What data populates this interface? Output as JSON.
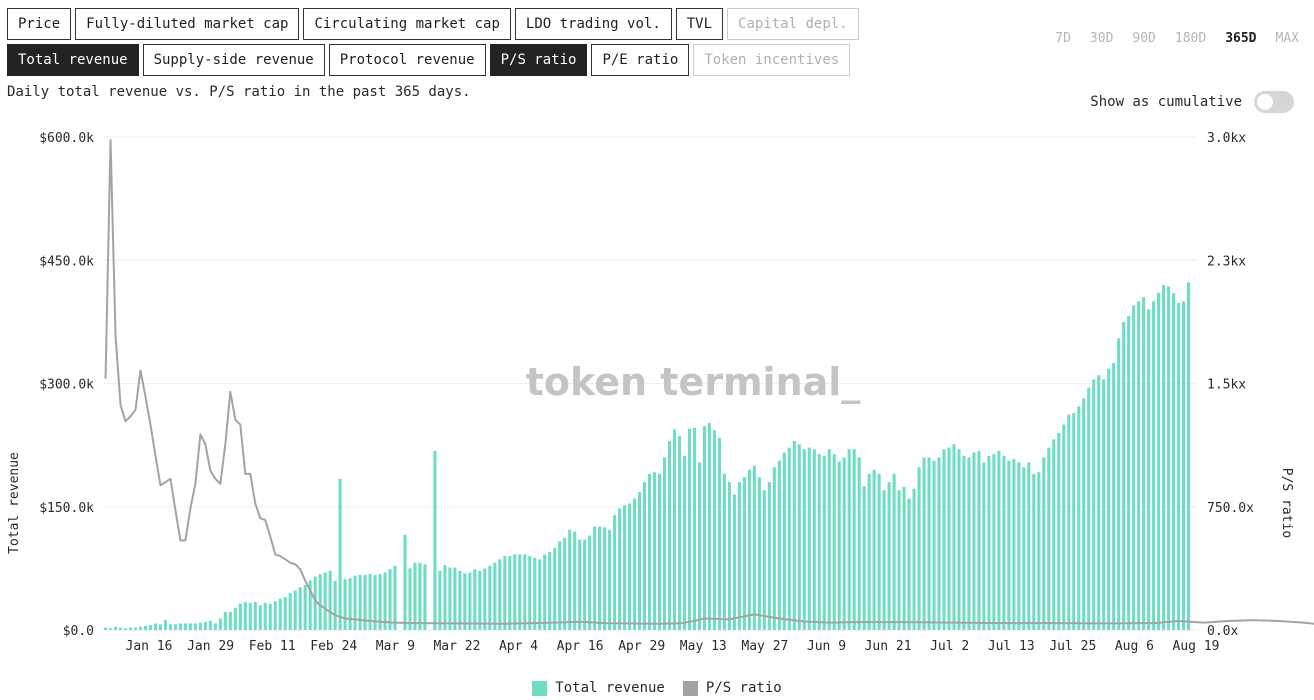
{
  "tabs_row1": [
    {
      "label": "Price",
      "state": "normal"
    },
    {
      "label": "Fully-diluted market cap",
      "state": "normal"
    },
    {
      "label": "Circulating market cap",
      "state": "normal"
    },
    {
      "label": "LDO trading vol.",
      "state": "normal"
    },
    {
      "label": "TVL",
      "state": "normal"
    },
    {
      "label": "Capital depl.",
      "state": "disabled"
    }
  ],
  "tabs_row2": [
    {
      "label": "Total revenue",
      "state": "active"
    },
    {
      "label": "Supply-side revenue",
      "state": "normal"
    },
    {
      "label": "Protocol revenue",
      "state": "normal"
    },
    {
      "label": "P/S ratio",
      "state": "active"
    },
    {
      "label": "P/E ratio",
      "state": "normal"
    },
    {
      "label": "Token incentives",
      "state": "disabled"
    }
  ],
  "ranges": [
    {
      "label": "7D",
      "active": false
    },
    {
      "label": "30D",
      "active": false
    },
    {
      "label": "90D",
      "active": false
    },
    {
      "label": "180D",
      "active": false
    },
    {
      "label": "365D",
      "active": true
    },
    {
      "label": "MAX",
      "active": false
    }
  ],
  "subtitle": "Daily total revenue vs. P/S ratio in the past 365 days.",
  "cumulative_label": "Show as cumulative",
  "cumulative_on": false,
  "watermark": "token terminal_",
  "colors": {
    "revenue": "#6fdcc3",
    "ps": "#a3a3a3",
    "grid": "#eeeeee",
    "text": "#2a2a2a"
  },
  "chart_data": {
    "type": "bar+line",
    "ylabel_left": "Total revenue",
    "ylabel_right": "P/S ratio",
    "left_ticks": [
      "$0.0",
      "$150.0k",
      "$300.0k",
      "$450.0k",
      "$600.0k"
    ],
    "right_ticks": [
      "0.0x",
      "750.0x",
      "1.5kx",
      "2.3kx",
      "3.0kx"
    ],
    "ylim_left": [
      0,
      600000
    ],
    "ylim_right": [
      0,
      3000
    ],
    "x_ticks": [
      "Jan 16",
      "Jan 29",
      "Feb 11",
      "Feb 24",
      "Mar 9",
      "Mar 22",
      "Apr 4",
      "Apr 16",
      "Apr 29",
      "May 13",
      "May 27",
      "Jun 9",
      "Jun 21",
      "Jul 2",
      "Jul 13",
      "Jul 25",
      "Aug 6",
      "Aug 19"
    ],
    "grid": true,
    "legend": "bottom-center",
    "series": [
      {
        "name": "Total revenue",
        "kind": "bar",
        "values": [
          3000,
          2000,
          4000,
          3000,
          2000,
          3000,
          3000,
          4000,
          5000,
          6000,
          8000,
          7000,
          12000,
          7000,
          7000,
          8000,
          8000,
          8000,
          8000,
          9000,
          10000,
          11000,
          8000,
          14000,
          22000,
          22000,
          27000,
          32000,
          34000,
          33000,
          34000,
          30000,
          33000,
          32000,
          35000,
          38000,
          40000,
          45000,
          48000,
          52000,
          55000,
          60000,
          65000,
          68000,
          70000,
          72000,
          60000,
          184000,
          62000,
          63000,
          66000,
          67000,
          67000,
          68000,
          67000,
          68000,
          70000,
          74000,
          78000,
          0,
          116000,
          75000,
          82000,
          82000,
          80000,
          0,
          218000,
          72000,
          79000,
          76000,
          76000,
          72000,
          69000,
          70000,
          74000,
          72000,
          75000,
          78000,
          82000,
          86000,
          90000,
          90000,
          92000,
          92000,
          92000,
          90000,
          88000,
          86000,
          92000,
          95000,
          100000,
          108000,
          112000,
          122000,
          120000,
          110000,
          110000,
          115000,
          126000,
          126000,
          125000,
          122000,
          140000,
          148000,
          152000,
          154000,
          160000,
          168000,
          180000,
          190000,
          192000,
          190000,
          210000,
          230000,
          244000,
          236000,
          212000,
          245000,
          246000,
          204000,
          248000,
          252000,
          243000,
          234000,
          190000,
          180000,
          165000,
          180000,
          186000,
          195000,
          200000,
          186000,
          170000,
          180000,
          198000,
          206000,
          216000,
          222000,
          230000,
          226000,
          220000,
          222000,
          220000,
          214000,
          212000,
          220000,
          214000,
          205000,
          210000,
          220000,
          220000,
          210000,
          175000,
          190000,
          195000,
          190000,
          170000,
          180000,
          190000,
          170000,
          174000,
          160000,
          172000,
          198000,
          210000,
          210000,
          206000,
          210000,
          220000,
          222000,
          226000,
          220000,
          212000,
          210000,
          216000,
          218000,
          204000,
          212000,
          214000,
          218000,
          212000,
          206000,
          208000,
          204000,
          198000,
          204000,
          190000,
          192000,
          210000,
          222000,
          232000,
          240000,
          250000,
          262000,
          264000,
          272000,
          282000,
          295000,
          305000,
          310000,
          305000,
          318000,
          325000,
          355000,
          375000,
          382000,
          395000,
          400000,
          405000,
          390000,
          400000,
          410000,
          420000,
          418000,
          410000,
          398000,
          400000,
          423000
        ]
      },
      {
        "name": "P/S ratio",
        "kind": "line",
        "points": [
          [
            0,
            1530
          ],
          [
            1,
            2980
          ],
          [
            2,
            1790
          ],
          [
            3,
            1370
          ],
          [
            4,
            1270
          ],
          [
            5,
            1300
          ],
          [
            6,
            1340
          ],
          [
            7,
            1580
          ],
          [
            8,
            1420
          ],
          [
            9,
            1250
          ],
          [
            10,
            1060
          ],
          [
            11,
            880
          ],
          [
            12,
            900
          ],
          [
            13,
            920
          ],
          [
            14,
            730
          ],
          [
            15,
            545
          ],
          [
            16,
            545
          ],
          [
            17,
            740
          ],
          [
            18,
            890
          ],
          [
            19,
            1190
          ],
          [
            20,
            1130
          ],
          [
            21,
            970
          ],
          [
            22,
            920
          ],
          [
            23,
            890
          ],
          [
            24,
            1130
          ],
          [
            25,
            1450
          ],
          [
            26,
            1280
          ],
          [
            27,
            1250
          ],
          [
            28,
            950
          ],
          [
            29,
            950
          ],
          [
            30,
            770
          ],
          [
            31,
            680
          ],
          [
            32,
            670
          ],
          [
            33,
            570
          ],
          [
            34,
            460
          ],
          [
            35,
            450
          ],
          [
            36,
            430
          ],
          [
            37,
            410
          ],
          [
            38,
            400
          ],
          [
            39,
            370
          ],
          [
            40,
            300
          ],
          [
            41,
            240
          ],
          [
            42,
            180
          ],
          [
            43,
            150
          ],
          [
            44,
            130
          ],
          [
            45,
            110
          ],
          [
            46,
            90
          ],
          [
            47,
            80
          ],
          [
            48,
            70
          ],
          [
            50,
            65
          ],
          [
            52,
            58
          ],
          [
            55,
            50
          ],
          [
            58,
            45
          ],
          [
            62,
            42
          ],
          [
            70,
            40
          ],
          [
            80,
            38
          ],
          [
            90,
            45
          ],
          [
            95,
            50
          ],
          [
            100,
            42
          ],
          [
            110,
            38
          ],
          [
            115,
            40
          ],
          [
            118,
            55
          ],
          [
            120,
            70
          ],
          [
            125,
            65
          ],
          [
            130,
            95
          ],
          [
            135,
            70
          ],
          [
            140,
            52
          ],
          [
            145,
            45
          ],
          [
            150,
            48
          ],
          [
            160,
            48
          ],
          [
            170,
            45
          ],
          [
            180,
            42
          ],
          [
            190,
            42
          ],
          [
            200,
            40
          ],
          [
            210,
            42
          ],
          [
            215,
            55
          ],
          [
            220,
            45
          ],
          [
            225,
            55
          ],
          [
            230,
            60
          ],
          [
            235,
            55
          ],
          [
            240,
            45
          ],
          [
            243,
            35
          ]
        ]
      }
    ]
  }
}
